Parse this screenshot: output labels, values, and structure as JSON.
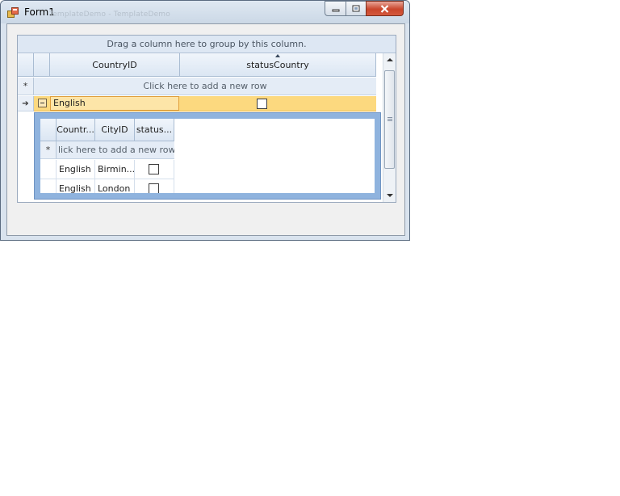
{
  "window": {
    "title": "Form1",
    "title_ghost": "TemplateDemo - TemplateDemo"
  },
  "grid": {
    "group_panel_text": "Drag a column here to group by this column.",
    "columns": [
      "CountryID",
      "statusCountry"
    ],
    "new_row_text": "Click here to add a new row",
    "new_row_indicator": "*",
    "current_row_indicator": "➔",
    "selected_row": {
      "CountryID": "English",
      "statusCountry": false
    }
  },
  "detail": {
    "columns": [
      "Countr...",
      "CityID",
      "status..."
    ],
    "new_row_text": "lick here to add a new row",
    "new_row_indicator": "*",
    "rows": [
      {
        "country": "English",
        "city": "Birmin...",
        "status": false
      },
      {
        "country": "English",
        "city": "London",
        "status": false
      }
    ]
  },
  "colors": {
    "selected_row": "#fcd97f",
    "detail_border": "#8fb3de",
    "header": "#dbe6f3",
    "close_button": "#c9462c"
  }
}
